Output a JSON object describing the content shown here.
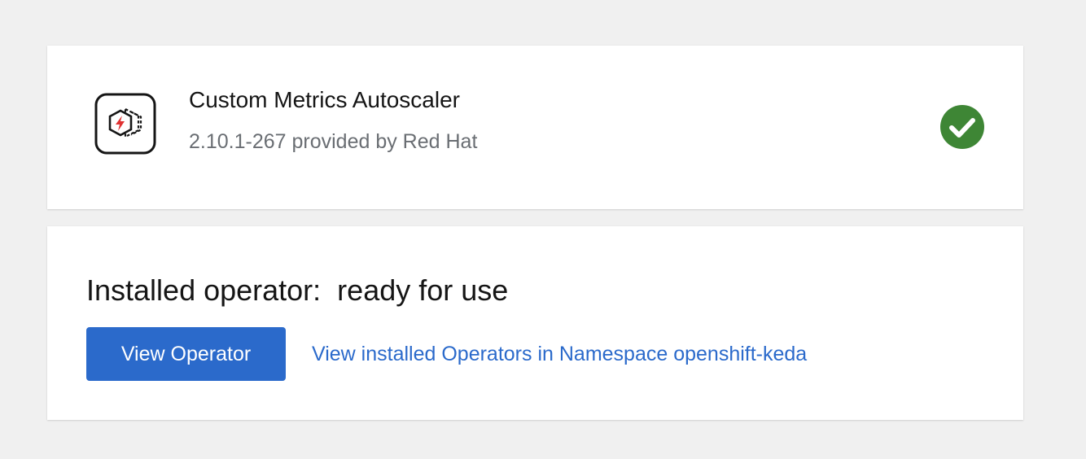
{
  "operator": {
    "name": "Custom Metrics Autoscaler",
    "provider": "2.10.1-267 provided by Red Hat",
    "logo_icon": "custom-metrics-autoscaler-logo",
    "status_icon": "check-circle-icon"
  },
  "install_status": {
    "title": "Installed operator:  ready for use",
    "view_button_label": "View Operator",
    "namespace_link": "View installed Operators in Namespace openshift-keda"
  },
  "colors": {
    "page_background": "#f0f0f0",
    "card_background": "#ffffff",
    "success_green": "#3e8635",
    "primary_blue": "#2b6acb",
    "logo_red": "#e03232",
    "secondary_text": "#6a6e73"
  }
}
